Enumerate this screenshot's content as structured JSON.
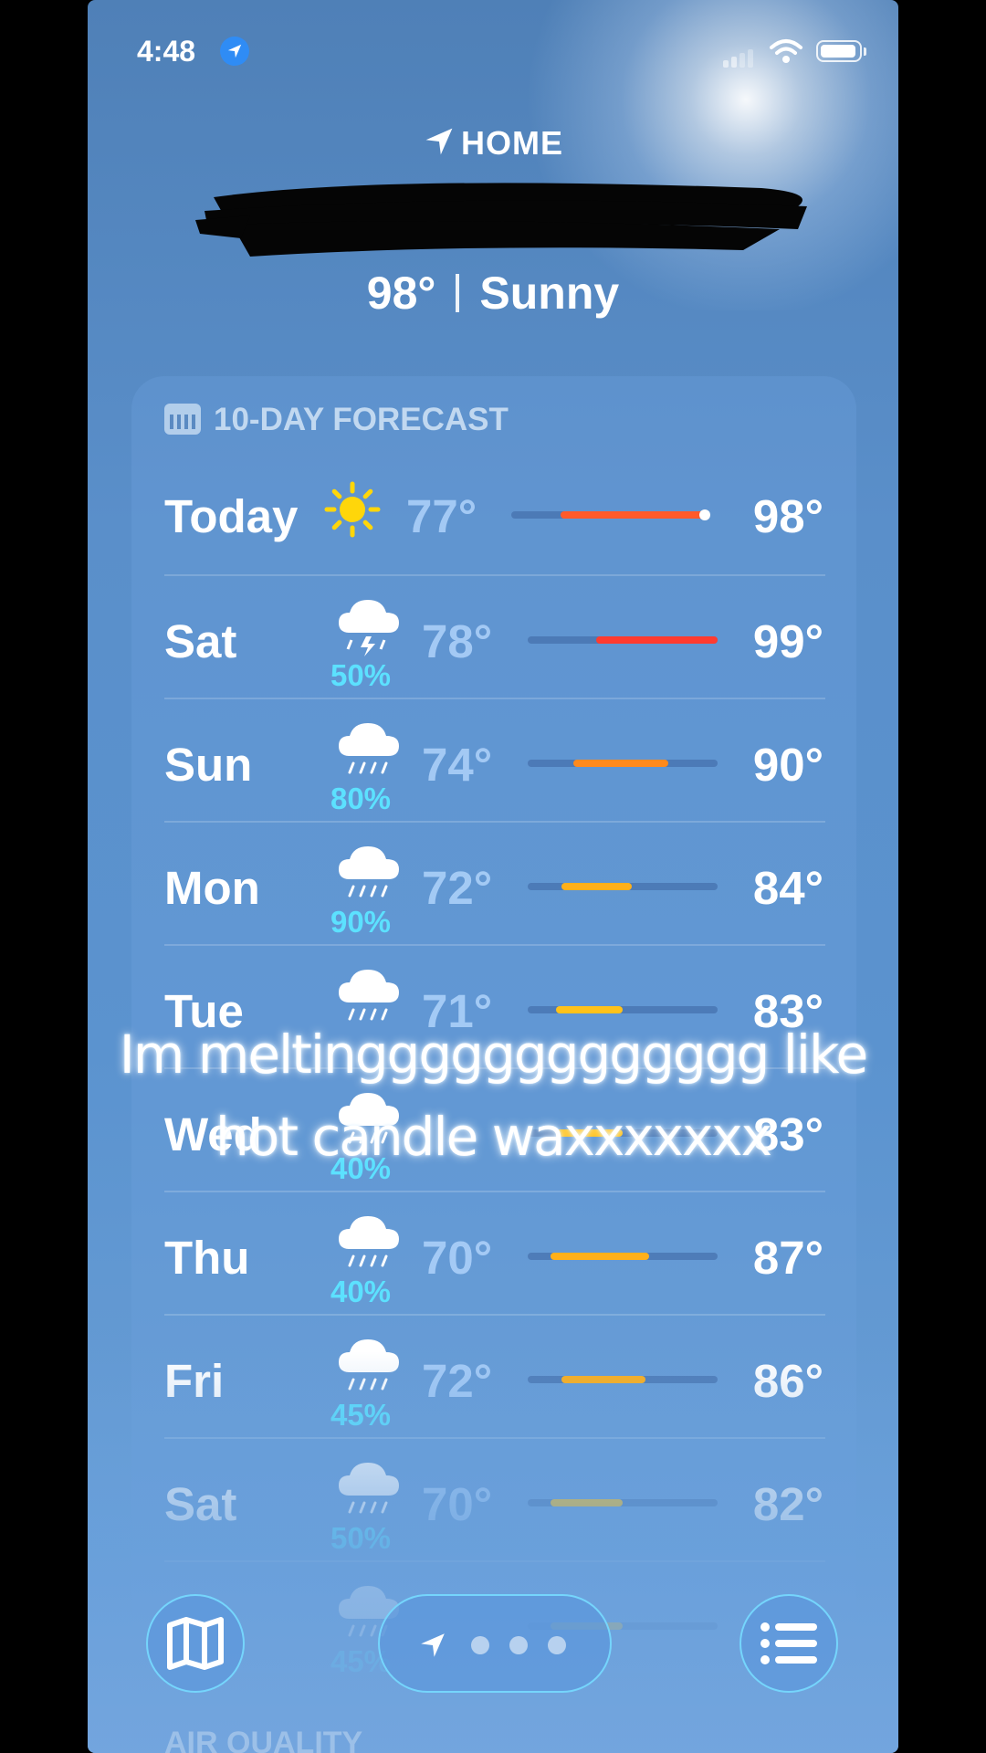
{
  "status": {
    "time": "4:48"
  },
  "location": {
    "label": "HOME"
  },
  "current": {
    "temp": "98°",
    "condition": "Sunny"
  },
  "forecast": {
    "header": "10-DAY FORECAST",
    "days": [
      {
        "day": "Today",
        "icon": "sun-icon",
        "pct": "",
        "lo": "77°",
        "hi": "98°",
        "range": [
          0.25,
          1.0
        ],
        "color": "#ff5a2a"
      },
      {
        "day": "Sat",
        "icon": "thunderstorm-icon",
        "pct": "50%",
        "lo": "78°",
        "hi": "99°",
        "range": [
          0.36,
          1.0
        ],
        "color": "#ff3b30"
      },
      {
        "day": "Sun",
        "icon": "rain-icon",
        "pct": "80%",
        "lo": "74°",
        "hi": "90°",
        "range": [
          0.24,
          0.74
        ],
        "color": "#ff8a1c"
      },
      {
        "day": "Mon",
        "icon": "rain-icon",
        "pct": "90%",
        "lo": "72°",
        "hi": "84°",
        "range": [
          0.18,
          0.55
        ],
        "color": "#ffb01a"
      },
      {
        "day": "Tue",
        "icon": "rain-icon",
        "pct": "",
        "lo": "71°",
        "hi": "83°",
        "range": [
          0.15,
          0.5
        ],
        "color": "#ffc21a"
      },
      {
        "day": "Wed",
        "icon": "rain-icon",
        "pct": "40%",
        "lo": "",
        "hi": "83°",
        "range": [
          0.15,
          0.5
        ],
        "color": "#ffc21a"
      },
      {
        "day": "Thu",
        "icon": "rain-icon",
        "pct": "40%",
        "lo": "70°",
        "hi": "87°",
        "range": [
          0.12,
          0.64
        ],
        "color": "#ffb01a"
      },
      {
        "day": "Fri",
        "icon": "rain-icon",
        "pct": "45%",
        "lo": "72°",
        "hi": "86°",
        "range": [
          0.18,
          0.62
        ],
        "color": "#ffb01a"
      },
      {
        "day": "Sat",
        "icon": "rain-icon",
        "pct": "50%",
        "lo": "70°",
        "hi": "82°",
        "range": [
          0.12,
          0.5
        ],
        "color": "#ffc21a"
      },
      {
        "day": "",
        "icon": "rain-icon",
        "pct": "45%",
        "lo": "",
        "hi": "",
        "range": [
          0.12,
          0.5
        ],
        "color": "#ffc21a"
      }
    ]
  },
  "caption": {
    "line1": "Im meltinggggggggggggg like",
    "line2": "hot candle waxxxxxxx"
  },
  "next_section": "AIR QUALITY"
}
